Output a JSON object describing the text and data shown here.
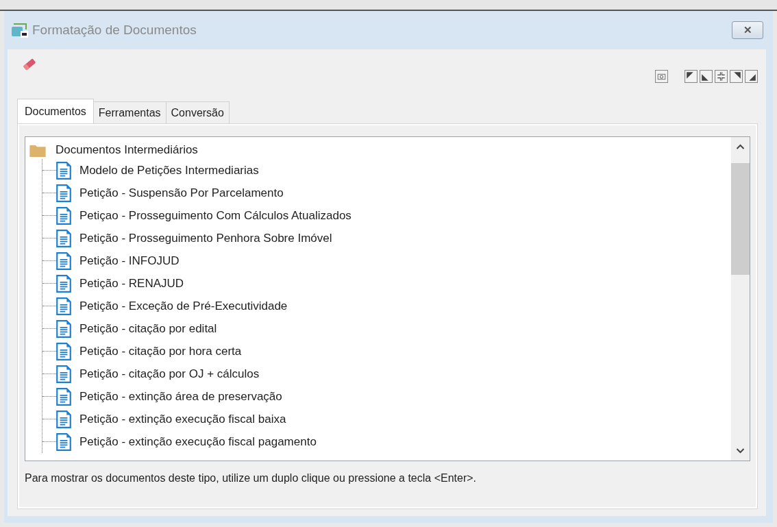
{
  "window": {
    "title": "Formatação de Documentos",
    "close": "✕"
  },
  "tabs": [
    {
      "label": "Documentos",
      "selected": true
    },
    {
      "label": "Ferramentas",
      "selected": false
    },
    {
      "label": "Conversão",
      "selected": false
    }
  ],
  "tree": {
    "label": "Documentos Intermediários",
    "children": [
      {
        "label": "Modelo de Petições Intermediarias"
      },
      {
        "label": "Petição - Suspensão Por Parcelamento"
      },
      {
        "label": "Petiçao - Prosseguimento Com Cálculos Atualizados"
      },
      {
        "label": "Petição - Prosseguimento Penhora Sobre Imóvel"
      },
      {
        "label": "Petição - INFOJUD"
      },
      {
        "label": "Petição - RENAJUD"
      },
      {
        "label": "Petição - Exceção de Pré-Executividade"
      },
      {
        "label": "Petição - citação por edital"
      },
      {
        "label": "Petição - citação por hora certa"
      },
      {
        "label": "Petição - citação por OJ + cálculos"
      },
      {
        "label": "Petição - extinção área de preservação"
      },
      {
        "label": "Petição - extinção execução fiscal baixa"
      },
      {
        "label": "Petição - extinção execução fiscal pagamento"
      }
    ]
  },
  "hint": "Para mostrar os documentos deste tipo, utilize um duplo clique ou pressione a tecla <Enter>."
}
